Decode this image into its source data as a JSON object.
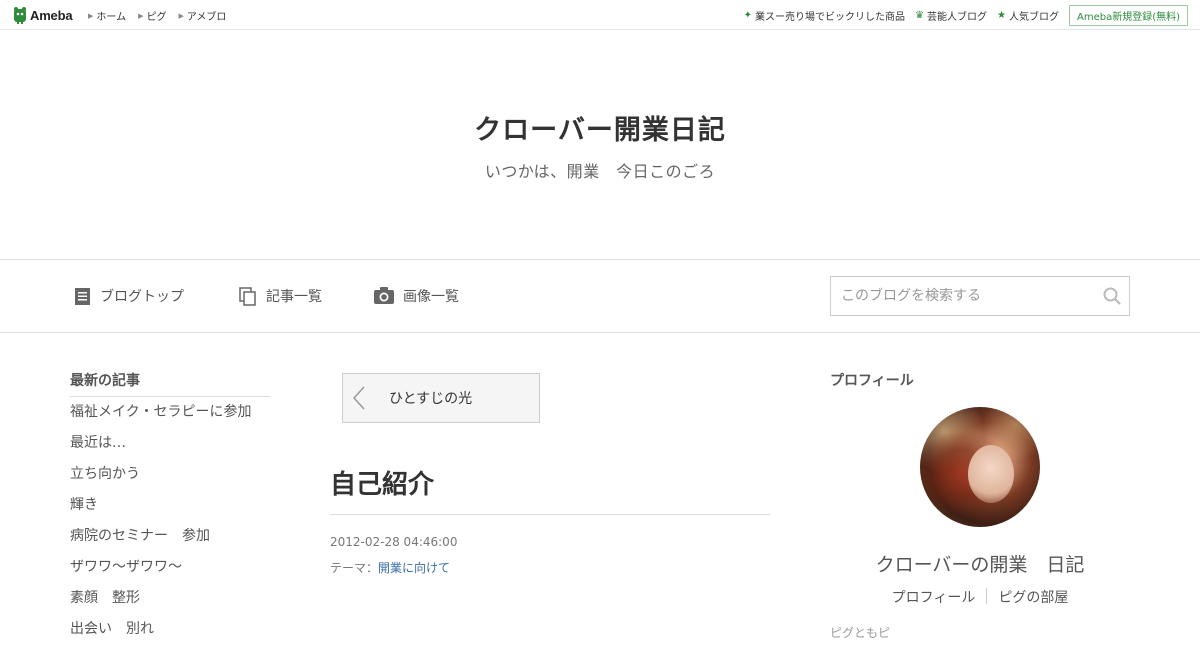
{
  "topbar": {
    "logo_text": "Ameba",
    "nav": [
      "ホーム",
      "ピグ",
      "アメブロ"
    ],
    "links": [
      {
        "icon": "sparkle-icon",
        "label": "業スー売り場でビックリした商品"
      },
      {
        "icon": "crown-icon",
        "label": "芸能人ブログ"
      },
      {
        "icon": "star-icon",
        "label": "人気ブログ"
      }
    ],
    "signup_label": "Ameba新規登録(無料)",
    "accent_color": "#2d8c3c"
  },
  "blog": {
    "title": "クローバー開業日記",
    "subtitle": "いつかは、開業　今日このごろ"
  },
  "blognav": {
    "items": [
      "ブログトップ",
      "記事一覧",
      "画像一覧"
    ],
    "search_placeholder": "このブログを検索する"
  },
  "recent": {
    "title": "最新の記事",
    "items": [
      "福祉メイク・セラピーに参加",
      "最近は…",
      "立ち向かう",
      "輝き",
      "病院のセミナー　参加",
      "ザワワ～ザワワ～",
      "素顔　整形",
      "出会い　別れ"
    ]
  },
  "entry": {
    "prev_label": "ひとすじの光",
    "title": "自己紹介",
    "datetime": "2012-02-28 04:46:00",
    "theme_prefix": "テーマ：",
    "theme_label": "開業に向けて",
    "link_color": "#3a6ea5"
  },
  "profile": {
    "title": "プロフィール",
    "name": "クローバーの開業　日記",
    "links": [
      "プロフィール",
      "ピグの部屋"
    ],
    "cutoff_text": "ピグともピ"
  }
}
